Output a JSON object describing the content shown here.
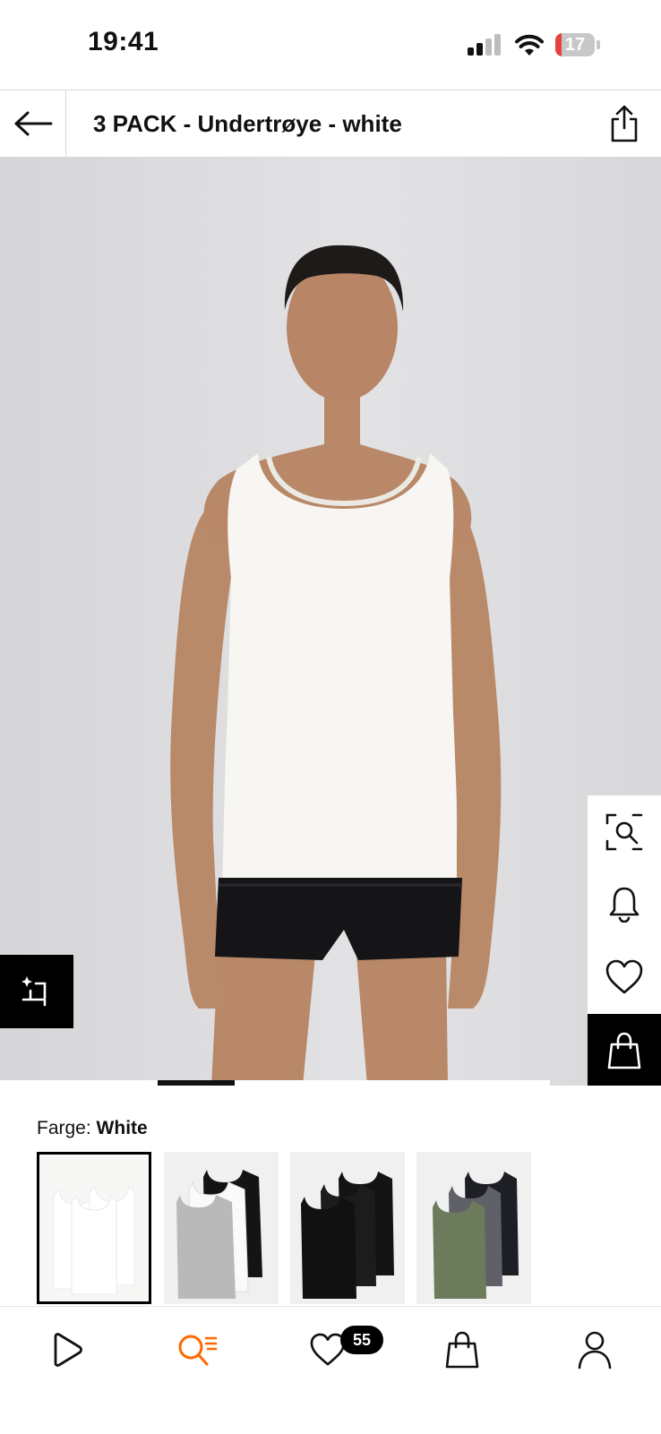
{
  "status_bar": {
    "time": "19:41",
    "battery": "17",
    "battery_level": 0.17
  },
  "header": {
    "title": "3 PACK - Undertrøye - white"
  },
  "carousel": {
    "current_index": 2
  },
  "colors": {
    "label": "Farge:",
    "selected": "White",
    "options": [
      {
        "name": "white",
        "swatch": "#ffffff",
        "selected": true
      },
      {
        "name": "grey-black-white",
        "swatch": "#b9b9b9"
      },
      {
        "name": "black",
        "swatch": "#141414"
      },
      {
        "name": "green-grey-black",
        "swatch": "#6c7b5b"
      }
    ]
  },
  "nav": {
    "items": [
      {
        "name": "discover",
        "icon": "play-icon"
      },
      {
        "name": "search",
        "icon": "search-list-icon",
        "active": true
      },
      {
        "name": "wishlist",
        "icon": "heart-icon"
      },
      {
        "name": "bag",
        "icon": "bag-icon"
      },
      {
        "name": "profile",
        "icon": "user-icon"
      }
    ],
    "wishlist_count": "55"
  },
  "theme": {
    "accent": "#ff6900",
    "battery_low": "#e8403c",
    "text": "#111111"
  }
}
